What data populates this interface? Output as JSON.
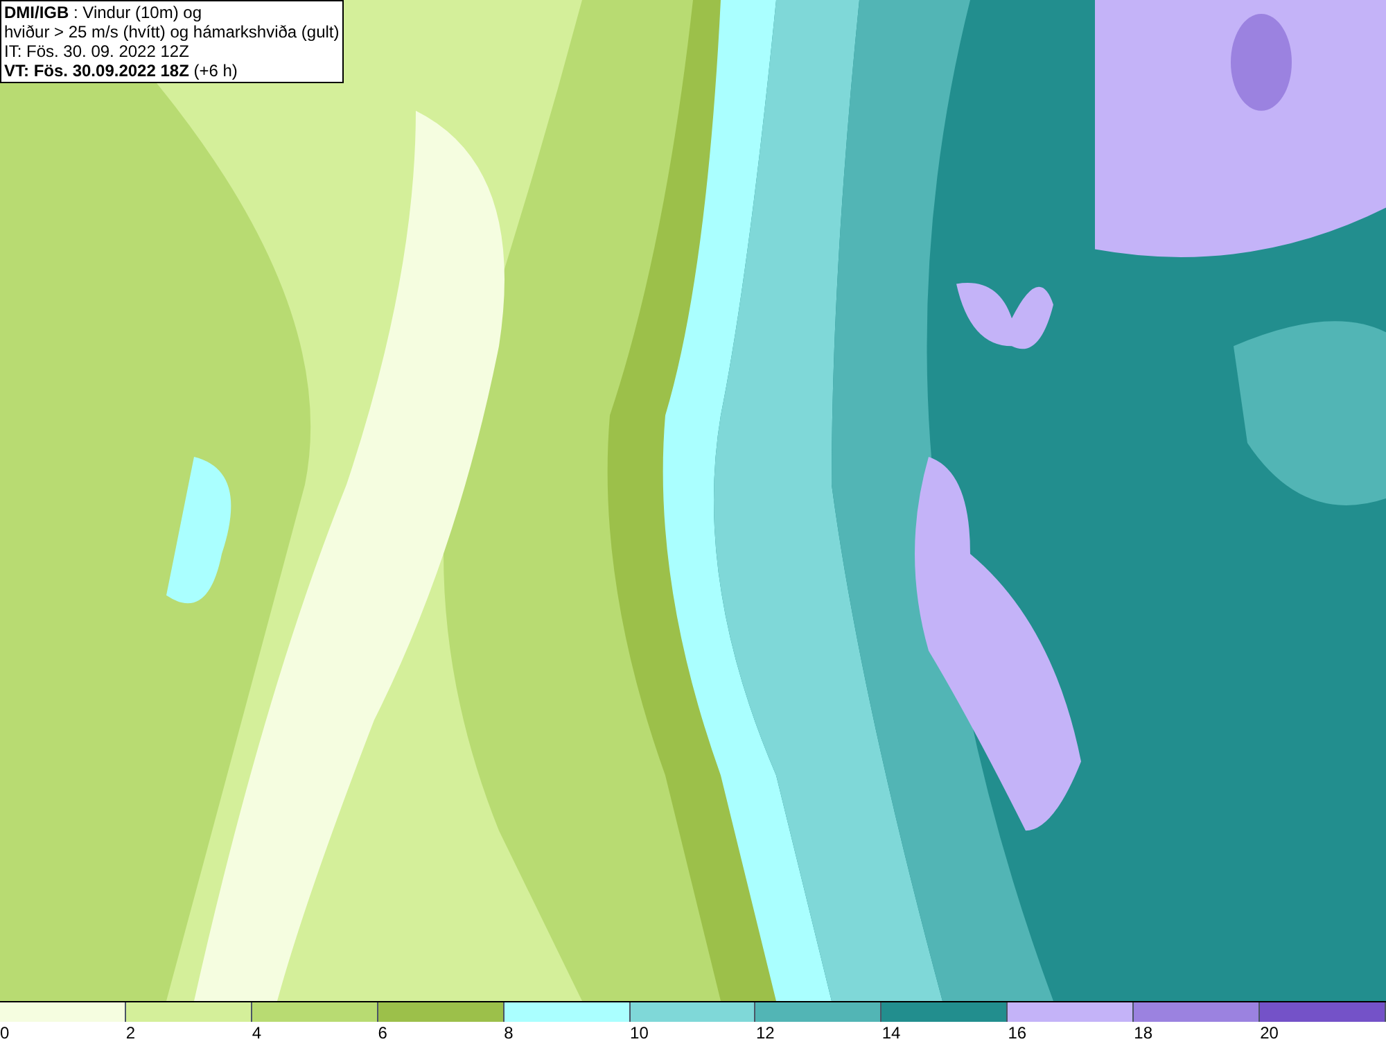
{
  "title_box": {
    "lines": [
      "**DMI/IGB** : Vindur (10m) og",
      "hviður > 25 m/s (hvítt) og hámarkshviða (gult)",
      "IT: Fös. 30. 09. 2022 12Z",
      "**VT: Fös. 30.09.2022 18Z** (+6 h)"
    ]
  },
  "legend": {
    "swatches": [
      {
        "color": "#f5fde0",
        "label": "0"
      },
      {
        "color": "#d4ef9a",
        "label": "2"
      },
      {
        "color": "#b8db72",
        "label": "4"
      },
      {
        "color": "#9cc04a",
        "label": "6"
      },
      {
        "color": "#aaffff",
        "label": "8"
      },
      {
        "color": "#7fd8d8",
        "label": "10"
      },
      {
        "color": "#52b5b5",
        "label": "12"
      },
      {
        "color": "#228e8e",
        "label": "14"
      },
      {
        "color": "#c4b3f8",
        "label": "16"
      },
      {
        "color": "#9b82e0",
        "label": "18"
      },
      {
        "color": "#7452c8",
        "label": "20"
      }
    ]
  }
}
